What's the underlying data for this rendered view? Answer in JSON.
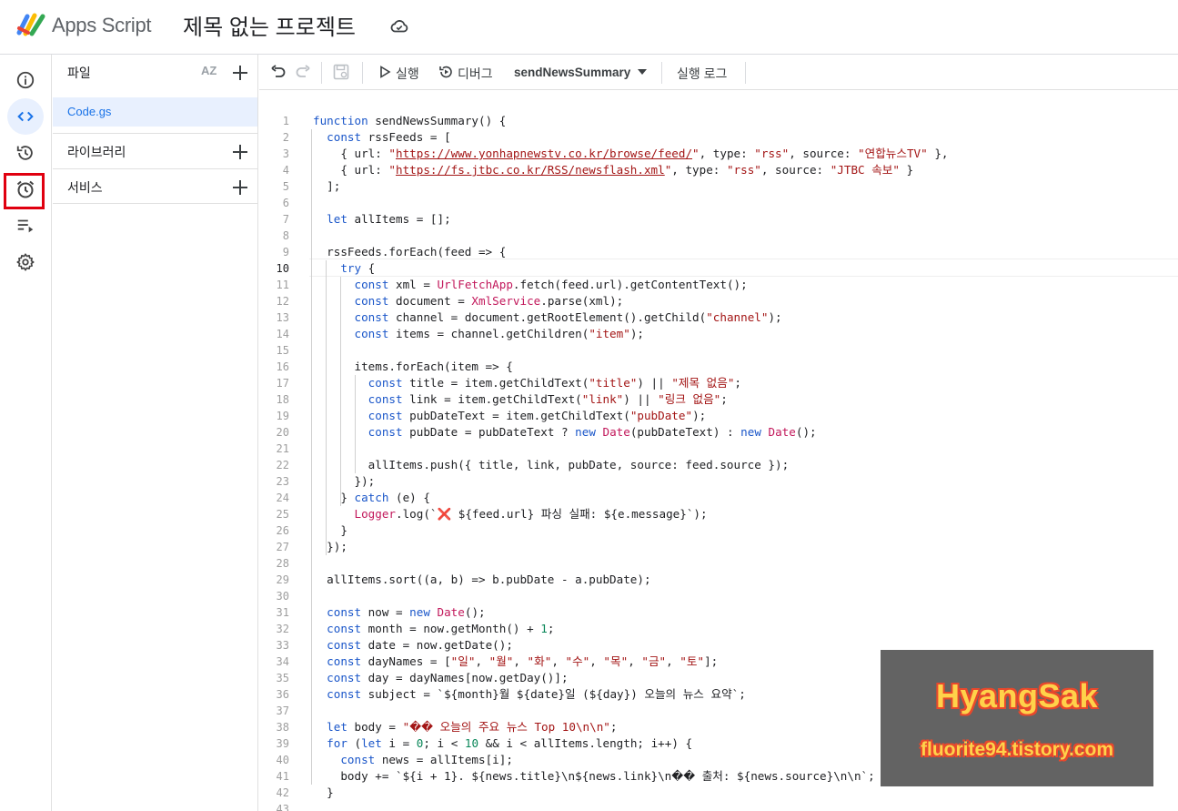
{
  "app": {
    "name": "Apps Script",
    "project_title": "제목 없는 프로젝트"
  },
  "rail": {
    "items": [
      {
        "icon": "info-icon",
        "label": "개요"
      },
      {
        "icon": "code-icon",
        "label": "편집기",
        "active": true
      },
      {
        "icon": "history-icon",
        "label": "버전"
      },
      {
        "icon": "alarm-clock-icon",
        "label": "트리거",
        "highlighted": true
      },
      {
        "icon": "executions-icon",
        "label": "실행"
      },
      {
        "icon": "gear-icon",
        "label": "설정"
      }
    ]
  },
  "files_panel": {
    "title": "파일",
    "sort_label": "AZ",
    "files": [
      "Code.gs"
    ],
    "sections": [
      "라이브러리",
      "서비스"
    ]
  },
  "toolbar": {
    "run_label": "실행",
    "debug_label": "디버그",
    "function_select": "sendNewsSummary",
    "log_label": "실행 로그"
  },
  "editor": {
    "current_line": 10,
    "lines": [
      "function sendNewsSummary() {",
      "  const rssFeeds = [",
      "    { url: \"https://www.yonhapnewstv.co.kr/browse/feed/\", type: \"rss\", source: \"연합뉴스TV\" },",
      "    { url: \"https://fs.jtbc.co.kr/RSS/newsflash.xml\", type: \"rss\", source: \"JTBC 속보\" }",
      "  ];",
      "",
      "  let allItems = [];",
      "",
      "  rssFeeds.forEach(feed => {",
      "    try {",
      "      const xml = UrlFetchApp.fetch(feed.url).getContentText();",
      "      const document = XmlService.parse(xml);",
      "      const channel = document.getRootElement().getChild(\"channel\");",
      "      const items = channel.getChildren(\"item\");",
      "",
      "      items.forEach(item => {",
      "        const title = item.getChildText(\"title\") || \"제목 없음\";",
      "        const link = item.getChildText(\"link\") || \"링크 없음\";",
      "        const pubDateText = item.getChildText(\"pubDate\");",
      "        const pubDate = pubDateText ? new Date(pubDateText) : new Date();",
      "",
      "        allItems.push({ title, link, pubDate, source: feed.source });",
      "      });",
      "    } catch (e) {",
      "      Logger.log(`❌ ${feed.url} 파싱 실패: ${e.message}`);",
      "    }",
      "  });",
      "",
      "  allItems.sort((a, b) => b.pubDate - a.pubDate);",
      "",
      "  const now = new Date();",
      "  const month = now.getMonth() + 1;",
      "  const date = now.getDate();",
      "  const dayNames = [\"일\", \"월\", \"화\", \"수\", \"목\", \"금\", \"토\"];",
      "  const day = dayNames[now.getDay()];",
      "  const subject = `${month}월 ${date}일 (${day}) 오늘의 뉴스 요약`;",
      "",
      "  let body = \"📘 오늘의 주요 뉴스 Top 10\\n\\n\";",
      "  for (let i = 0; i < 10 && i < allItems.length; i++) {",
      "    const news = allItems[i];",
      "    body += `${i + 1}. ${news.title}\\n${news.link}\\n📌 출처: ${news.source}\\n\\n`;",
      "  }",
      ""
    ]
  },
  "watermark": {
    "title": "HyangSak",
    "url": "fluorite94.tistory.com"
  },
  "colors": {
    "accent": "#1a73e8",
    "highlight_box": "#e0000f",
    "keyword": "#1a56c9",
    "string": "#a31515",
    "builtin": "#c2185b"
  }
}
